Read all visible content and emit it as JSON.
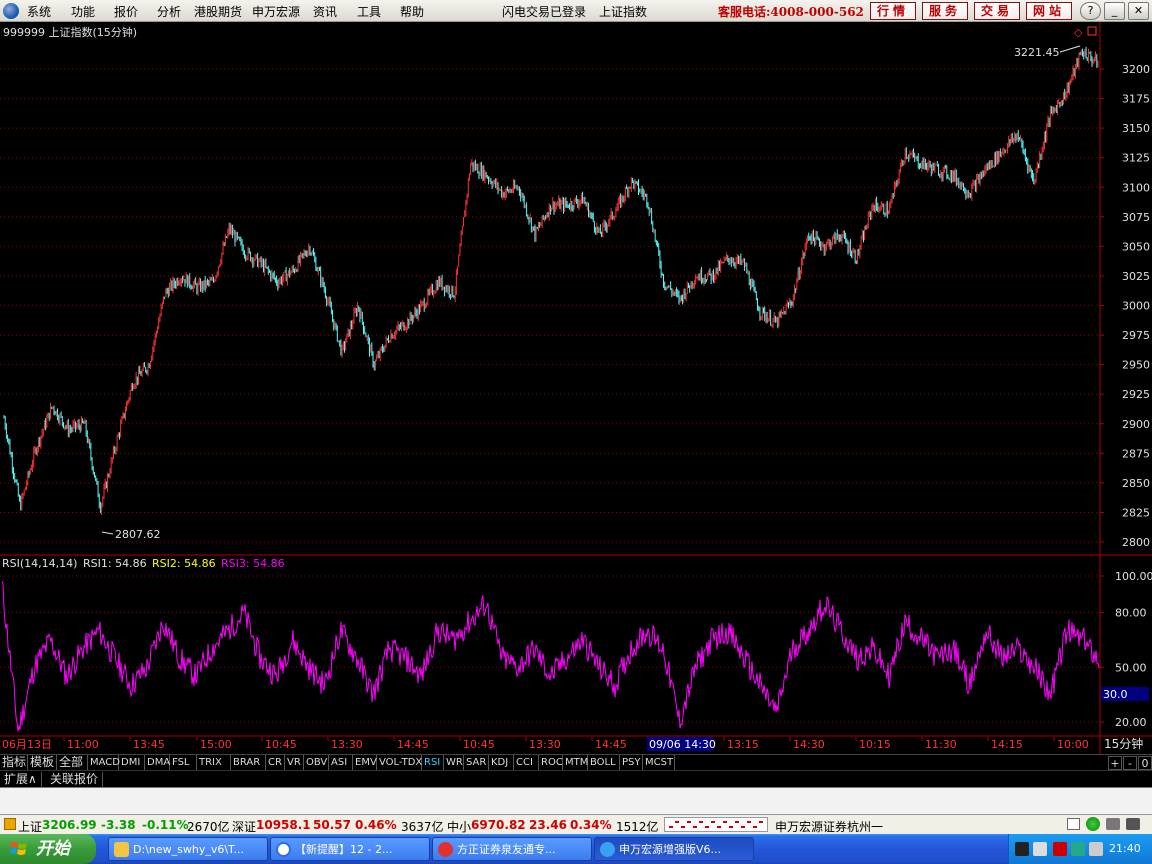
{
  "menubar": {
    "items": [
      "系统",
      "功能",
      "报价",
      "分析",
      "港股期货",
      "申万宏源",
      "资讯",
      "工具",
      "帮助"
    ],
    "center": [
      "闪电交易已登录",
      "上证指数"
    ],
    "hotline": "客服电话:4008-000-562",
    "quick_buttons": [
      "行情",
      "服务",
      "交易",
      "网站"
    ],
    "window_buttons": [
      "?",
      "_",
      "▣",
      "✕"
    ]
  },
  "chart": {
    "title": "999999 上证指数(15分钟)",
    "high_label": "3221.45",
    "low_label": "2807.62",
    "price_ticks": [
      "3200",
      "3175",
      "3150",
      "3125",
      "3100",
      "3075",
      "3050",
      "3025",
      "3000",
      "2975",
      "2950",
      "2925",
      "2900",
      "2875",
      "2850",
      "2825",
      "2800"
    ],
    "rsi_header": {
      "name": "RSI(14,14,14)",
      "rsi1": "RSI1: 54.86",
      "rsi2": "RSI2: 54.86",
      "rsi3": "RSI3: 54.86"
    },
    "rsi_ticks": [
      "100.00",
      "80.00",
      "50.00",
      "20.00"
    ],
    "rsi_cursor_value": "30.0",
    "time_labels": [
      "06月13日",
      "11:00",
      "13:45",
      "15:00",
      "10:45",
      "13:30",
      "14:45",
      "10:45",
      "13:30",
      "14:45",
      "09/06 14:30",
      "13:15",
      "14:30",
      "10:15",
      "11:30",
      "14:15",
      "10:00"
    ],
    "period_label": "15分钟",
    "colors": {
      "up": "#ff3232",
      "down": "#54fcfc",
      "rsi": "#ff00ff",
      "grid": "#8b0000"
    }
  },
  "chart_data": {
    "type": "candlestick",
    "title": "999999 上证指数(15分钟)",
    "ylim": [
      2800,
      3225
    ],
    "high": 3221.45,
    "low": 2807.62,
    "close_path": [
      2905,
      2830,
      2880,
      2915,
      2895,
      2900,
      2830,
      2885,
      2935,
      2950,
      3010,
      3025,
      3015,
      3020,
      3065,
      3045,
      3035,
      3020,
      3030,
      3050,
      3010,
      2960,
      3000,
      2950,
      2975,
      2985,
      3000,
      3020,
      3010,
      3120,
      3110,
      3095,
      3100,
      3060,
      3085,
      3085,
      3090,
      3060,
      3080,
      3105,
      3090,
      3020,
      3005,
      3025,
      3025,
      3040,
      3035,
      2995,
      2985,
      3005,
      3060,
      3050,
      3060,
      3040,
      3085,
      3080,
      3130,
      3120,
      3115,
      3110,
      3095,
      3115,
      3130,
      3145,
      3105,
      3160,
      3180,
      3215,
      3205
    ],
    "rsi": {
      "series": [
        {
          "name": "RSI1",
          "last": 54.86
        },
        {
          "name": "RSI2",
          "last": 54.86
        },
        {
          "name": "RSI3",
          "last": 54.86
        }
      ],
      "ylim": [
        10,
        100
      ],
      "path": [
        95,
        15,
        50,
        65,
        45,
        60,
        70,
        55,
        40,
        50,
        75,
        55,
        45,
        60,
        70,
        80,
        55,
        45,
        65,
        50,
        40,
        70,
        55,
        35,
        60,
        55,
        45,
        70,
        65,
        75,
        85,
        55,
        50,
        60,
        45,
        55,
        65,
        50,
        40,
        60,
        70,
        60,
        20,
        50,
        65,
        70,
        55,
        40,
        25,
        60,
        70,
        85,
        70,
        55,
        60,
        45,
        75,
        65,
        55,
        60,
        40,
        70,
        55,
        60,
        50,
        35,
        70,
        65,
        55
      ]
    }
  },
  "tabs": [
    "指标",
    "模板",
    "全部",
    "MACD",
    "DMI",
    "DMA",
    "FSL",
    "TRIX",
    "BRAR",
    "CR",
    "VR",
    "OBV",
    "ASI",
    "EMV",
    "VOL-TDX",
    "RSI",
    "WR",
    "SAR",
    "KDJ",
    "CCI",
    "ROC",
    "MTM",
    "BOLL",
    "PSY",
    "MCST"
  ],
  "active_tab": "RSI",
  "bottom_ctrl": [
    "+",
    "-",
    "0"
  ],
  "tabs2": [
    "扩展∧",
    "关联报价"
  ],
  "status": {
    "sh_name": "上证",
    "sh_price": "3206.99",
    "sh_chg": "-3.38",
    "sh_pct": "-0.11%",
    "sh_amt": "2670亿",
    "sz_name": "深证",
    "sz_price": "10958.1",
    "sz_chg": "50.57",
    "sz_pct": "0.46%",
    "sz_amt": "3637亿",
    "zx_name": "中小",
    "zx_price": "6970.82",
    "zx_chg": "23.46",
    "zx_pct": "0.34%",
    "zx_amt": "1512亿",
    "broker": "申万宏源证券杭州一"
  },
  "taskbar": {
    "start": "开始",
    "tasks": [
      "D:\\new_swhy_v6\\T...",
      "【新提醒】12 - 2...",
      "方正证券泉友通专...",
      "申万宏源增强版V6..."
    ],
    "clock": "21:40"
  }
}
